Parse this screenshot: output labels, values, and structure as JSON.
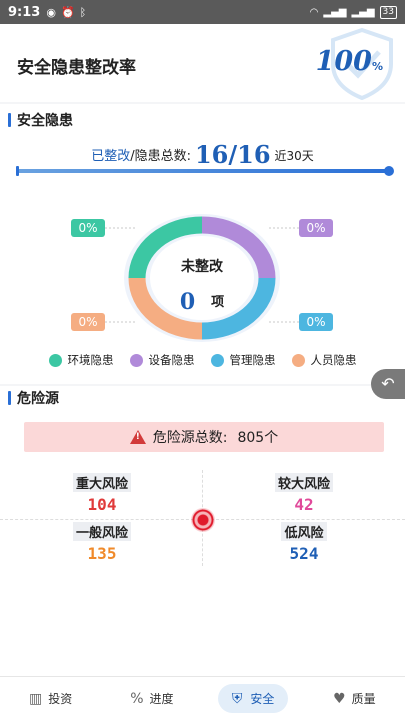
{
  "status": {
    "time": "9:13",
    "battery": "33"
  },
  "header": {
    "title": "安全隐患整改率",
    "rate": "100",
    "rate_unit": "%"
  },
  "hazard": {
    "section_title": "安全隐患",
    "fixed_label": "已整改",
    "total_label": "/隐患总数:",
    "ratio": "16/16",
    "period": "近30天",
    "progress": 1.0,
    "center_label": "未整改",
    "unfixed_count": "0",
    "unit": "项",
    "categories": [
      {
        "name": "环境隐患",
        "percent": "0%",
        "color": "#3cc7a3"
      },
      {
        "name": "设备隐患",
        "percent": "0%",
        "color": "#b08ad9"
      },
      {
        "name": "管理隐患",
        "percent": "0%",
        "color": "#4db6e0"
      },
      {
        "name": "人员隐患",
        "percent": "0%",
        "color": "#f5ad82"
      }
    ]
  },
  "danger": {
    "section_title": "危险源",
    "total_label": "危险源总数:",
    "total": "805个",
    "risks": [
      {
        "label": "重大风险",
        "value": "104",
        "color": "#e03a3a"
      },
      {
        "label": "较大风险",
        "value": "42",
        "color": "#e0499a"
      },
      {
        "label": "一般风险",
        "value": "135",
        "color": "#f08a2a"
      },
      {
        "label": "低风险",
        "value": "524",
        "color": "#1f5fb5"
      }
    ]
  },
  "tabs": [
    {
      "label": "投资",
      "icon": "bar-chart-icon"
    },
    {
      "label": "进度",
      "icon": "percent-icon"
    },
    {
      "label": "安全",
      "icon": "shield-icon"
    },
    {
      "label": "质量",
      "icon": "heart-icon"
    }
  ]
}
